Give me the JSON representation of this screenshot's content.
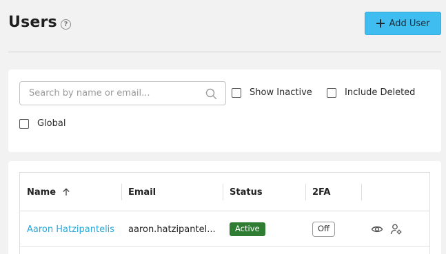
{
  "header": {
    "title": "Users",
    "help_glyph": "?",
    "add_user_label": "Add User"
  },
  "filters": {
    "search_placeholder": "Search by name or email...",
    "search_value": "",
    "show_inactive": {
      "label": "Show Inactive",
      "checked": false
    },
    "include_deleted": {
      "label": "Include Deleted",
      "checked": false
    },
    "global": {
      "label": "Global",
      "checked": false
    }
  },
  "table": {
    "columns": [
      "Name",
      "Email",
      "Status",
      "2FA",
      ""
    ],
    "sort": {
      "column": "Name",
      "direction": "ascending"
    },
    "rows": [
      {
        "name": "Aaron Hatzipantelis",
        "email": "aaron.hatzipantel...",
        "status": "Active",
        "two_fa": "Off",
        "actions": [
          "eye-icon",
          "user-settings-icon"
        ]
      }
    ]
  },
  "colors": {
    "accent": "#3fbdf0",
    "link": "#2aa7dc",
    "status_active": "#2e7d32",
    "background": "#f2f2f2"
  }
}
